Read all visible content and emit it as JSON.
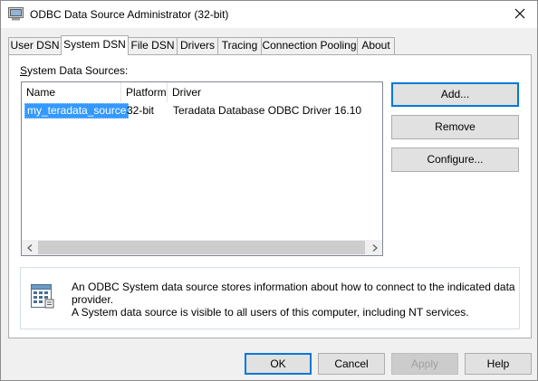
{
  "window": {
    "title": "ODBC Data Source Administrator (32-bit)",
    "close_glyph": "✕"
  },
  "tabs": [
    {
      "label": "User DSN",
      "active": false
    },
    {
      "label": "System DSN",
      "active": true
    },
    {
      "label": "File DSN",
      "active": false
    },
    {
      "label": "Drivers",
      "active": false
    },
    {
      "label": "Tracing",
      "active": false
    },
    {
      "label": "Connection Pooling",
      "active": false
    },
    {
      "label": "About",
      "active": false
    }
  ],
  "panel": {
    "list_label": "System Data Sources:",
    "columns": [
      "Name",
      "Platform",
      "Driver"
    ],
    "rows": [
      {
        "name": "my_teradata_source",
        "platform": "32-bit",
        "driver": "Teradata Database ODBC Driver 16.10",
        "selected": true
      }
    ],
    "buttons": {
      "add": "Add...",
      "remove": "Remove",
      "configure": "Configure..."
    },
    "info": {
      "line1": "An ODBC System data source stores information about how to connect to the indicated data provider.",
      "line2": "A System data source is visible to all users of this computer, including NT services."
    }
  },
  "footer": {
    "ok": "OK",
    "cancel": "Cancel",
    "apply": "Apply",
    "help": "Help"
  },
  "colors": {
    "selection": "#3399ff",
    "default_button_border": "#0078d7"
  },
  "icons": {
    "app": "odbc-admin-icon",
    "close": "close-icon",
    "info": "data-source-icon",
    "scroll_left": "chevron-left-icon",
    "scroll_right": "chevron-right-icon"
  }
}
